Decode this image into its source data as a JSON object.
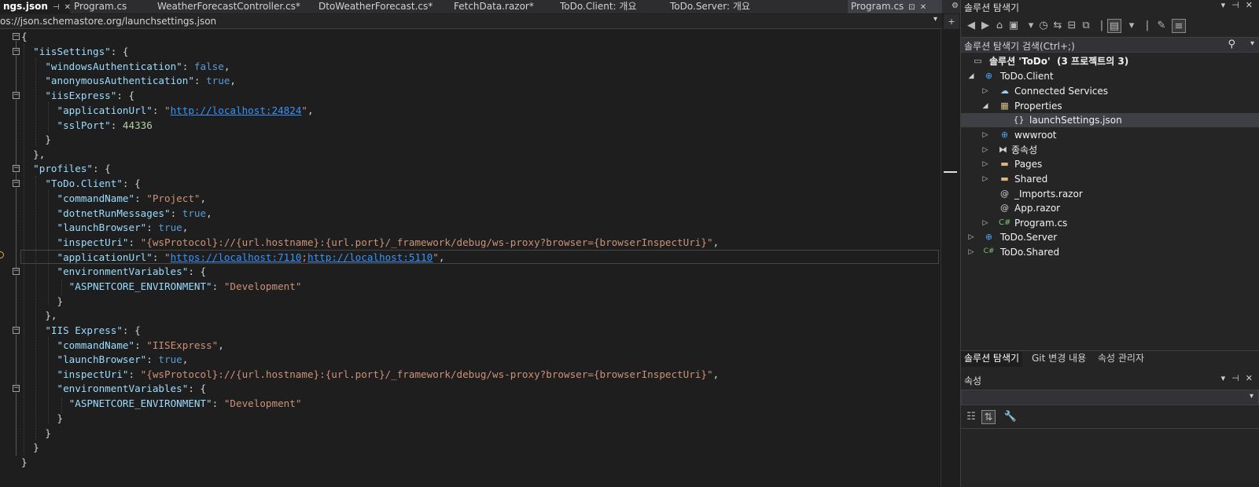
{
  "tabs": [
    {
      "label": "ngs.json",
      "active": true
    },
    {
      "label": "Program.cs"
    },
    {
      "label": "WeatherForecastController.cs*"
    },
    {
      "label": "DtoWeatherForecast.cs*"
    },
    {
      "label": "FetchData.razor*"
    },
    {
      "label": "ToDo.Client: 개요"
    },
    {
      "label": "ToDo.Server: 개요"
    },
    {
      "label": "Program.cs"
    }
  ],
  "schema_url": "os://json.schemastore.org/launchsettings.json",
  "code": {
    "l1": "{",
    "iisSettings_key": "\"iisSettings\"",
    "winAuth_key": "\"windowsAuthentication\"",
    "winAuth_val": "false",
    "anonAuth_key": "\"anonymousAuthentication\"",
    "anonAuth_val": "true",
    "iisExpress_key": "\"iisExpress\"",
    "appUrl_key": "\"applicationUrl\"",
    "iis_app_url": "http://localhost:24824",
    "sslPort_key": "\"sslPort\"",
    "sslPort_val": "44336",
    "profiles_key": "\"profiles\"",
    "client_key": "\"ToDo.Client\"",
    "commandName_key": "\"commandName\"",
    "client_commandName": "\"Project\"",
    "dotnetRun_key": "\"dotnetRunMessages\"",
    "dotnetRun_val": "true",
    "launchBrowser_key": "\"launchBrowser\"",
    "launchBrowser_val": "true",
    "inspectUri_key": "\"inspectUri\"",
    "inspectUri_val": "\"{wsProtocol}://{url.hostname}:{url.port}/_framework/debug/ws-proxy?browser={browserInspectUri}\"",
    "client_url_https": "https://localhost:7110",
    "client_url_http": "http://localhost:5110",
    "envVars_key": "\"environmentVariables\"",
    "aspnet_key": "\"ASPNETCORE_ENVIRONMENT\"",
    "aspnet_val": "\"Development\"",
    "iisexp_key": "\"IIS Express\"",
    "iisexp_commandName": "\"IISExpress\""
  },
  "solution_explorer": {
    "title": "솔루션 탐색기",
    "search_placeholder": "솔루션 탐색기 검색(Ctrl+;)",
    "solution_label": "솔루션 'ToDo'",
    "solution_count": "(3 프로젝트의 3)",
    "items": [
      {
        "label": "ToDo.Client"
      },
      {
        "label": "Connected Services"
      },
      {
        "label": "Properties"
      },
      {
        "label": "launchSettings.json"
      },
      {
        "label": "wwwroot"
      },
      {
        "label": "종속성"
      },
      {
        "label": "Pages"
      },
      {
        "label": "Shared"
      },
      {
        "label": "_Imports.razor"
      },
      {
        "label": "App.razor"
      },
      {
        "label": "Program.cs"
      },
      {
        "label": "ToDo.Server"
      },
      {
        "label": "ToDo.Shared"
      }
    ]
  },
  "panel_tabs": [
    "솔루션 탐색기",
    "Git 변경 내용",
    "속성 관리자"
  ],
  "properties_title": "속성"
}
